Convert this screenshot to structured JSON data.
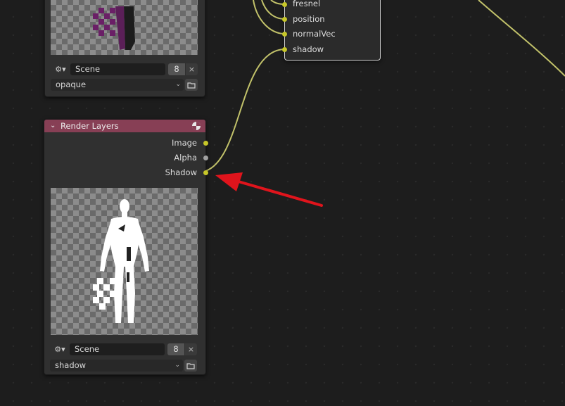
{
  "top_node": {
    "scene_label": "Scene",
    "scene_users": "8",
    "clear_glyph": "×",
    "view_layer": "opaque"
  },
  "render_layers_node": {
    "title": "Render Layers",
    "outputs": [
      "Image",
      "Alpha",
      "Shadow"
    ],
    "scene_label": "Scene",
    "scene_users": "8",
    "clear_glyph": "×",
    "view_layer": "shadow"
  },
  "group_node": {
    "inputs": [
      "fresnel",
      "position",
      "normalVec",
      "shadow"
    ]
  },
  "colors": {
    "header": "#873f55",
    "socket_color": "#c7c729",
    "socket_gray": "#a1a1a1",
    "wire": "#c2c26a",
    "arrow": "#e0141c"
  },
  "icons": {
    "scene_icon": "scene-icon",
    "collapse": "chevron-down-icon",
    "render": "render-icon",
    "browse": "folder-icon"
  }
}
